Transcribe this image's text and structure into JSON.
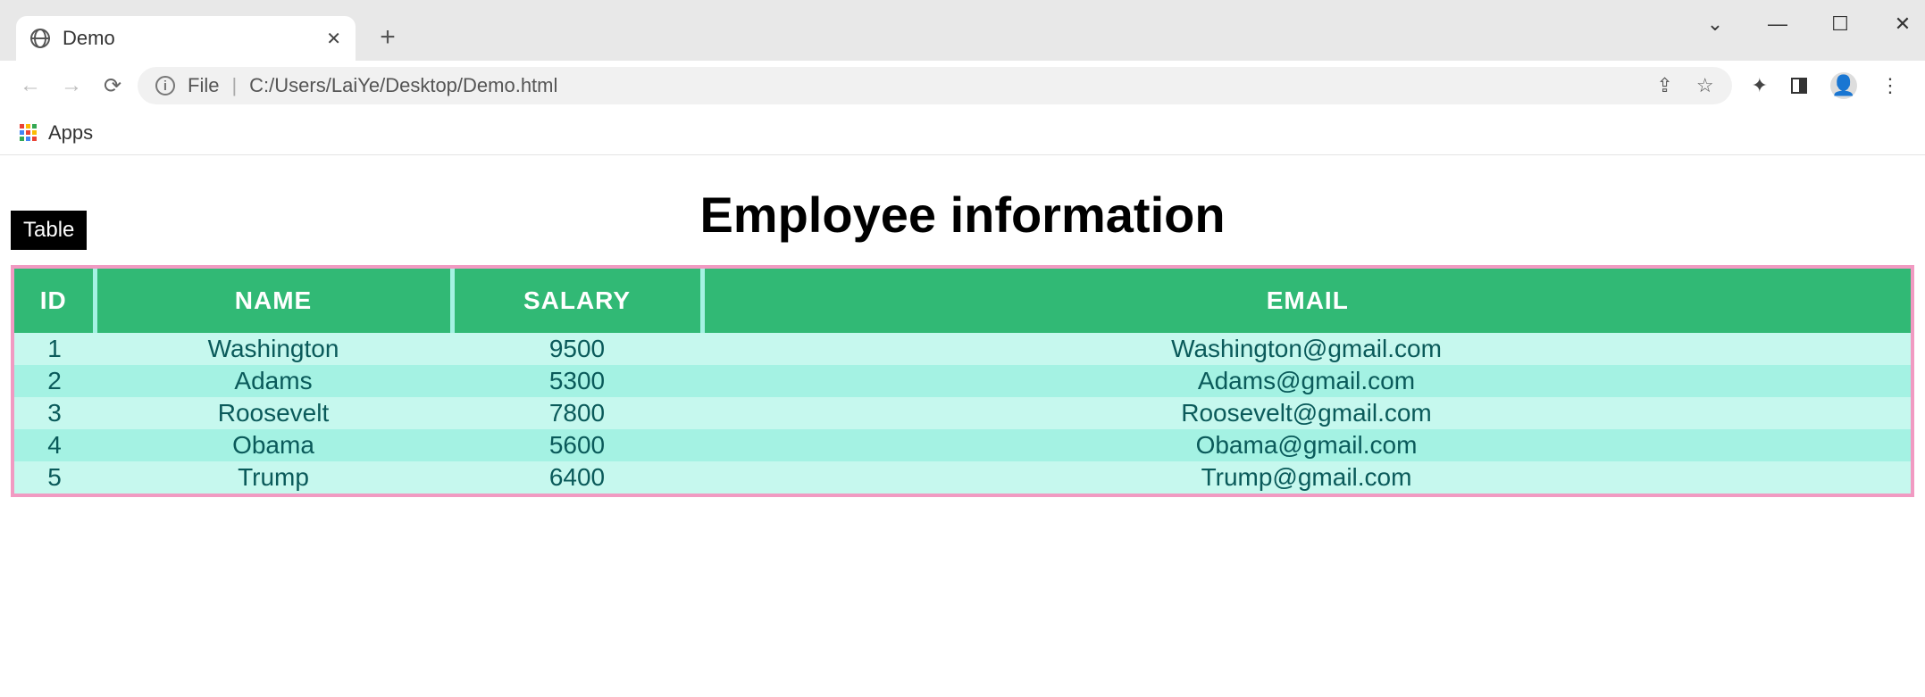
{
  "browser": {
    "tab_title": "Demo",
    "new_tab_tooltip": "New tab",
    "window": {
      "dropdown": "⌄",
      "minimize": "—",
      "maximize": "☐",
      "close": "✕"
    },
    "nav": {
      "back": "←",
      "forward": "→",
      "reload": "⟳"
    },
    "omnibox": {
      "scheme_label": "File",
      "separator": "|",
      "path": "C:/Users/LaiYe/Desktop/Demo.html"
    },
    "actions": {
      "share": "⇪",
      "star": "☆",
      "extensions": "✦",
      "panel": "",
      "profile": "",
      "menu": "⋮"
    },
    "bookmarks": {
      "apps_label": "Apps"
    }
  },
  "page": {
    "title": "Employee information",
    "caption": "Table",
    "columns": [
      "ID",
      "NAME",
      "SALARY",
      "EMAIL"
    ],
    "rows": [
      {
        "id": "1",
        "name": "Washington",
        "salary": "9500",
        "email": "Washington@gmail.com"
      },
      {
        "id": "2",
        "name": "Adams",
        "salary": "5300",
        "email": "Adams@gmail.com"
      },
      {
        "id": "3",
        "name": "Roosevelt",
        "salary": "7800",
        "email": "Roosevelt@gmail.com"
      },
      {
        "id": "4",
        "name": "Obama",
        "salary": "5600",
        "email": "Obama@gmail.com"
      },
      {
        "id": "5",
        "name": "Trump",
        "salary": "6400",
        "email": "Trump@gmail.com"
      }
    ]
  }
}
